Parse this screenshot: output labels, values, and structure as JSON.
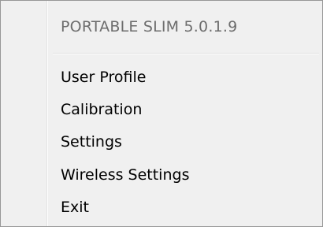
{
  "menu": {
    "header": "PORTABLE SLIM  5.0.1.9",
    "items": [
      {
        "label": "User Profile"
      },
      {
        "label": "Calibration"
      },
      {
        "label": "Settings"
      },
      {
        "label": "Wireless Settings"
      },
      {
        "label": "Exit"
      }
    ]
  }
}
